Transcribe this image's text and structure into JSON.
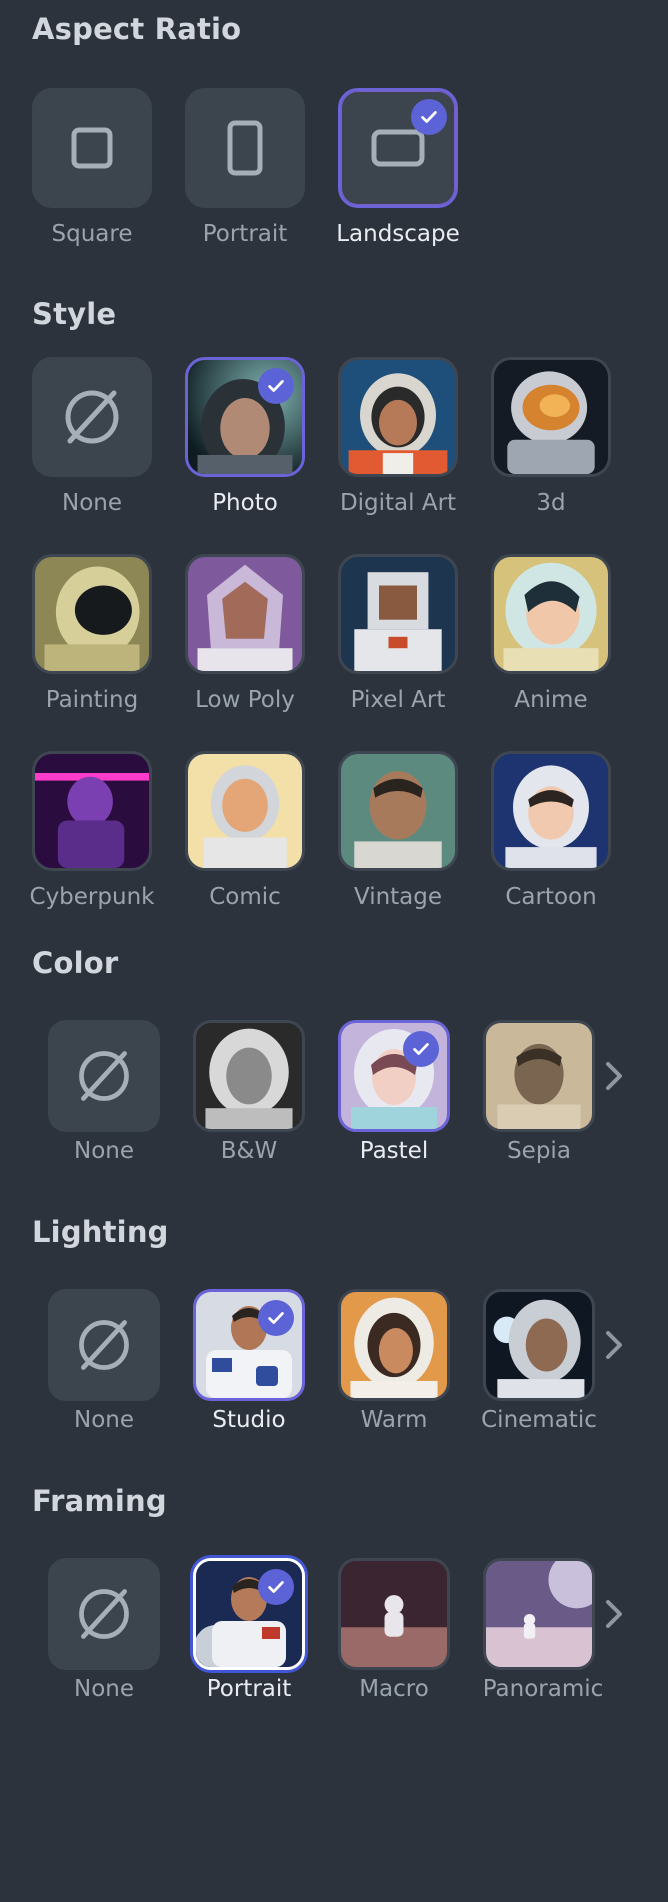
{
  "aspect": {
    "title": "Aspect Ratio",
    "items": [
      {
        "label": "Square",
        "icon": "square-icon",
        "selected": false
      },
      {
        "label": "Portrait",
        "icon": "portrait-icon",
        "selected": false
      },
      {
        "label": "Landscape",
        "icon": "landscape-icon",
        "selected": true
      }
    ]
  },
  "style": {
    "title": "Style",
    "items": [
      {
        "label": "None"
      },
      {
        "label": "Photo",
        "selected": true
      },
      {
        "label": "Digital Art"
      },
      {
        "label": "3d"
      },
      {
        "label": "Painting"
      },
      {
        "label": "Low Poly"
      },
      {
        "label": "Pixel Art"
      },
      {
        "label": "Anime"
      },
      {
        "label": "Cyberpunk"
      },
      {
        "label": "Comic"
      },
      {
        "label": "Vintage"
      },
      {
        "label": "Cartoon"
      }
    ]
  },
  "color": {
    "title": "Color",
    "items": [
      {
        "label": "None"
      },
      {
        "label": "B&W"
      },
      {
        "label": "Pastel",
        "selected": true
      },
      {
        "label": "Sepia"
      }
    ]
  },
  "lighting": {
    "title": "Lighting",
    "items": [
      {
        "label": "None"
      },
      {
        "label": "Studio",
        "selected": true
      },
      {
        "label": "Warm"
      },
      {
        "label": "Cinematic"
      }
    ]
  },
  "framing": {
    "title": "Framing",
    "items": [
      {
        "label": "None"
      },
      {
        "label": "Portrait",
        "selected": true
      },
      {
        "label": "Macro"
      },
      {
        "label": "Panoramic"
      }
    ]
  },
  "colors": {
    "background": "#2d333c",
    "tile": "#3c444e",
    "accent": "#5c63d6"
  }
}
